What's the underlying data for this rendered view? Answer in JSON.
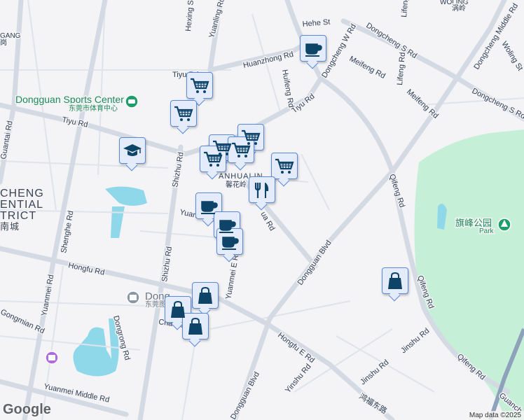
{
  "map": {
    "roads": {
      "tiyu": [
        "Tiyu Rd",
        "Tiyu Rd",
        "Tiyu Rd"
      ],
      "huanzhong": "Huanzhong Rd",
      "hehe": "Hehe St",
      "dongcheng_w": "Dongcheng W Rd",
      "dongcheng_s": [
        "Dongcheng S Rd",
        "Dongcheng S Rd"
      ],
      "dongcheng_middle": "Dongcheng Middle Rd",
      "meifeng": [
        "Meifeng Rd",
        "Meifeng Rd"
      ],
      "lifeng": "Lifeng Rd",
      "huifeng": "Huifeng Rd",
      "qifeng": [
        "Qifeng Rd",
        "Qifeng Rd",
        "Qifeng Rd"
      ],
      "dongguan_blvd": [
        "Dongguan Blvd",
        "Dongguan Blvd"
      ],
      "hongfu": "Hongfu Rd",
      "hongfu_e": "Hongfu E Rd",
      "hongfu_e_cn": "鸿福东路",
      "shizhu": [
        "Shizhu Rd",
        "Shizhu Rd"
      ],
      "yuanmei": "Yuanmei Rd",
      "yuanmei_e": "Yuanmei E Rd",
      "yuanmei_e2": "Yuanmei E",
      "yuanmei_middle": "Yuanmei Middle Rd",
      "shenghe": "Shenghe Rd",
      "dongrong": "Dongrong Rd",
      "chaoyang": "Chaoyang Rd",
      "jinshu": [
        "Jinshu Rd",
        "Jinshu Rd"
      ],
      "yinshu": "Yinshu Rd",
      "guantai": "Guantai Rd",
      "hexing": "Hexing St",
      "yuanling": "Yuanling Rd",
      "woling_st": "Woling St",
      "guanch": "Guanch",
      "gongmian": "Gongmian Rd",
      "xinhua": "ua Rd"
    },
    "areas": {
      "woling": "WOLING",
      "woling_cn": "涡岭",
      "gang": "GANG",
      "gang_cn": "岗",
      "nancheng_1": "CHENG",
      "nancheng_2": "ENTIAL",
      "nancheng_3": "TRICT",
      "nancheng_cn": "南城",
      "xinhualing": "ANHUALIN",
      "xinhualing_cn": "馨花岭"
    },
    "pois": {
      "sports_center": "Dongguan Sports Center",
      "sports_center_cn": "东莞市体育中心",
      "library": "Dong",
      "library_cn": "东莞图",
      "park_cn": "旗峰公园",
      "park": "Park"
    },
    "markers": [
      {
        "type": "cafe"
      },
      {
        "type": "cart"
      },
      {
        "type": "cart"
      },
      {
        "type": "school"
      },
      {
        "type": "cart"
      },
      {
        "type": "cart"
      },
      {
        "type": "cart"
      },
      {
        "type": "cart"
      },
      {
        "type": "cart"
      },
      {
        "type": "restaurant"
      },
      {
        "type": "cafe"
      },
      {
        "type": "cafe"
      },
      {
        "type": "cafe"
      },
      {
        "type": "bag"
      },
      {
        "type": "bag"
      },
      {
        "type": "bag"
      },
      {
        "type": "bag"
      }
    ],
    "colors": {
      "marker_bg": "#e4ecfb",
      "marker_border": "#5b8ad8",
      "icon": "#0d4468",
      "park": "#c5efd6",
      "water": "#8fd8ea"
    }
  },
  "footer": {
    "logo": "Google",
    "attribution": "Map data ©2025"
  }
}
